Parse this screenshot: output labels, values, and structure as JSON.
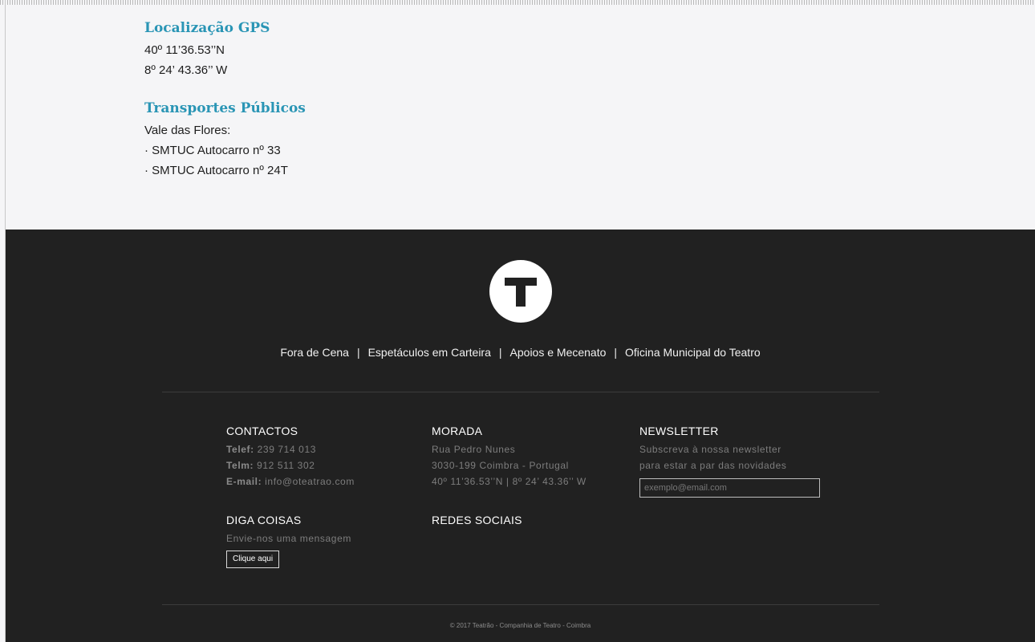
{
  "location": {
    "gps_title": "Localização GPS",
    "gps_lat": "40º 11’36.53’’N",
    "gps_lon": "8º 24’ 43.36’’ W",
    "transport_title": "Transportes Públicos",
    "transport_stop": "Vale das Flores:",
    "transport_lines": [
      "· SMTUC Autocarro nº 33",
      "· SMTUC Autocarro nº 24T"
    ]
  },
  "footer": {
    "nav": [
      "Fora de Cena",
      "Espetáculos em Carteira",
      "Apoios e Mecenato",
      "Oficina Municipal do Teatro"
    ],
    "nav_separator": "|",
    "contacts": {
      "title": "CONTACTOS",
      "phone_label": "Telef:",
      "phone": "239 714 013",
      "mobile_label": "Telm:",
      "mobile": "912 511 302",
      "email_label": "E-mail:",
      "email": "info@oteatrao.com"
    },
    "address": {
      "title": "MORADA",
      "street": "Rua Pedro Nunes",
      "city": "3030-199 Coimbra - Portugal",
      "gps": "40º 11’36.53’’N | 8º 24’ 43.36’’ W"
    },
    "newsletter": {
      "title": "NEWSLETTER",
      "text_line1": "Subscreva à nossa newsletter",
      "text_line2": "para estar a par das novidades",
      "placeholder": "exemplo@email.com"
    },
    "message": {
      "title": "DIGA COISAS",
      "text": "Envie-nos uma mensagem",
      "button": "Clique aqui"
    },
    "social": {
      "title": "REDES SOCIAIS"
    },
    "copyright": "© 2017 Teatrão - Companhia de Teatro - Coimbra"
  },
  "colors": {
    "accent": "#2a95b5",
    "footer_bg": "#212121",
    "page_bg": "#f5f5f7"
  }
}
